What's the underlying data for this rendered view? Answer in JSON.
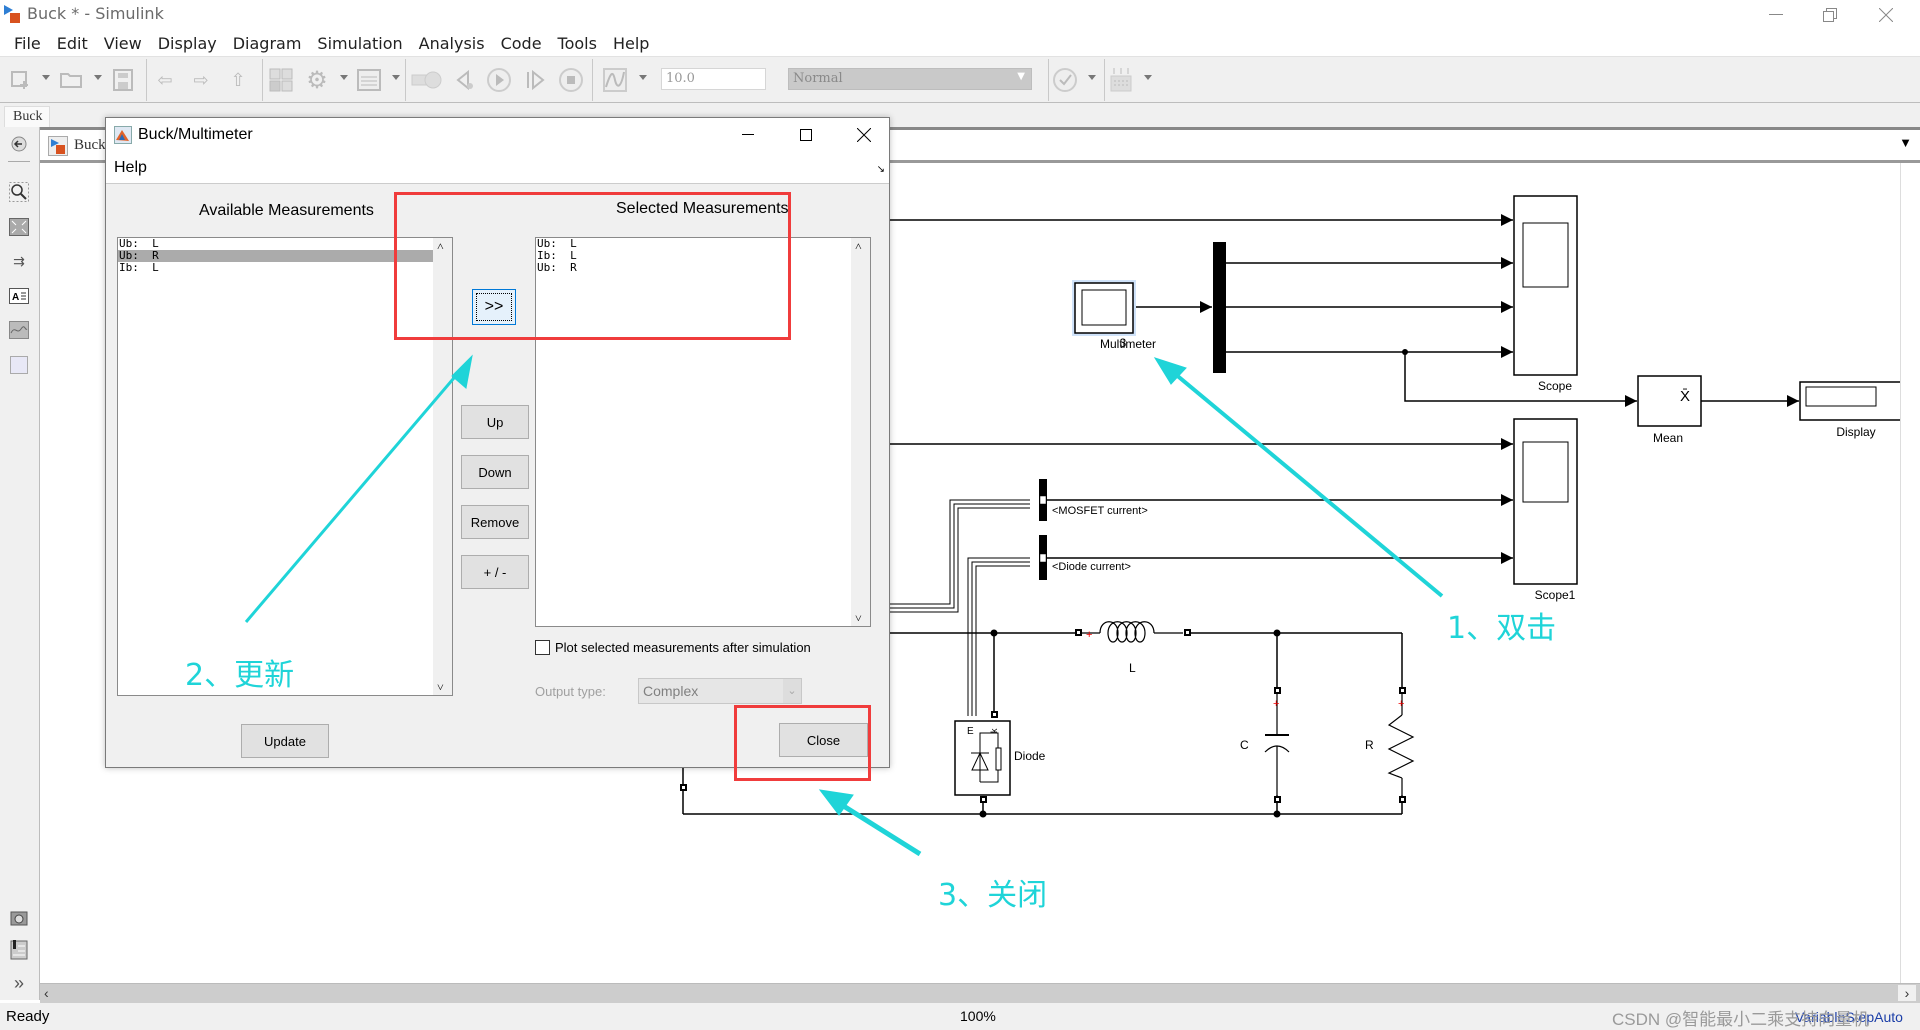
{
  "window": {
    "title": "Buck * - Simulink",
    "controls": {
      "minimize": "minimize-icon",
      "restore": "restore-icon",
      "close": "close-icon"
    }
  },
  "menu": [
    "File",
    "Edit",
    "View",
    "Display",
    "Diagram",
    "Simulation",
    "Analysis",
    "Code",
    "Tools",
    "Help"
  ],
  "toolbar": {
    "stop_time": "10.0",
    "sim_mode": "Normal",
    "icons": [
      "new-model-icon",
      "open-icon",
      "save-icon",
      "back-icon",
      "forward-icon",
      "up-icon",
      "library-browser-icon",
      "settings-icon",
      "model-explorer-icon",
      "step-back-icon",
      "run-icon",
      "step-forward-icon",
      "stop-icon",
      "data-inspector-icon",
      "check-icon",
      "build-icon"
    ]
  },
  "model_tab": "Buck",
  "breadcrumb": "Buck",
  "palette_icons": [
    "hide-browser-icon",
    "zoom-icon",
    "fit-view-icon",
    "route-lines-icon",
    "annotation-icon",
    "image-icon",
    "area-icon",
    "screenshot-icon",
    "property-inspector-icon",
    "expand-icon"
  ],
  "dialog": {
    "title": "Buck/Multimeter",
    "menu": "Help",
    "available_label": "Available Measurements",
    "selected_label": "Selected Measurements",
    "available": [
      {
        "text": "Ub:  L",
        "selected": false
      },
      {
        "text": "Ub:  R",
        "selected": true
      },
      {
        "text": "Ib:  L",
        "selected": false
      }
    ],
    "selected": [
      "Ub:  L",
      "Ib:  L",
      "Ub:  R"
    ],
    "add_button": ">>",
    "up_button": "Up",
    "down_button": "Down",
    "remove_button": "Remove",
    "sign_button": "+ / -",
    "plot_checkbox_label": "Plot selected measurements after simulation",
    "plot_checked": false,
    "output_type_label": "Output type:",
    "output_type_value": "Complex",
    "update_button": "Update",
    "close_button": "Close"
  },
  "diagram": {
    "blocks": {
      "multimeter": {
        "label": "Multimeter",
        "value": "3"
      },
      "scope": "Scope",
      "scope1": "Scope1",
      "mean": {
        "label": "Mean",
        "symbol": "X̄"
      },
      "display": "Display",
      "mosfet_current": "<MOSFET current>",
      "diode_current": "<Diode current>",
      "inductor": "L",
      "capacitor": "C",
      "resistor": "R",
      "diode": {
        "label": "Diode",
        "ports": [
          "E",
          "k"
        ]
      }
    }
  },
  "annotations": {
    "step1": "1、双击",
    "step2": "2、更新",
    "step3": "3、关闭",
    "color": "#1fd4d8",
    "highlight_color": "#f03c3c"
  },
  "status": {
    "left": "Ready",
    "zoom": "100%",
    "right": "VariableStepAuto"
  },
  "watermark": "CSDN @智能最小二乘支持向量机"
}
